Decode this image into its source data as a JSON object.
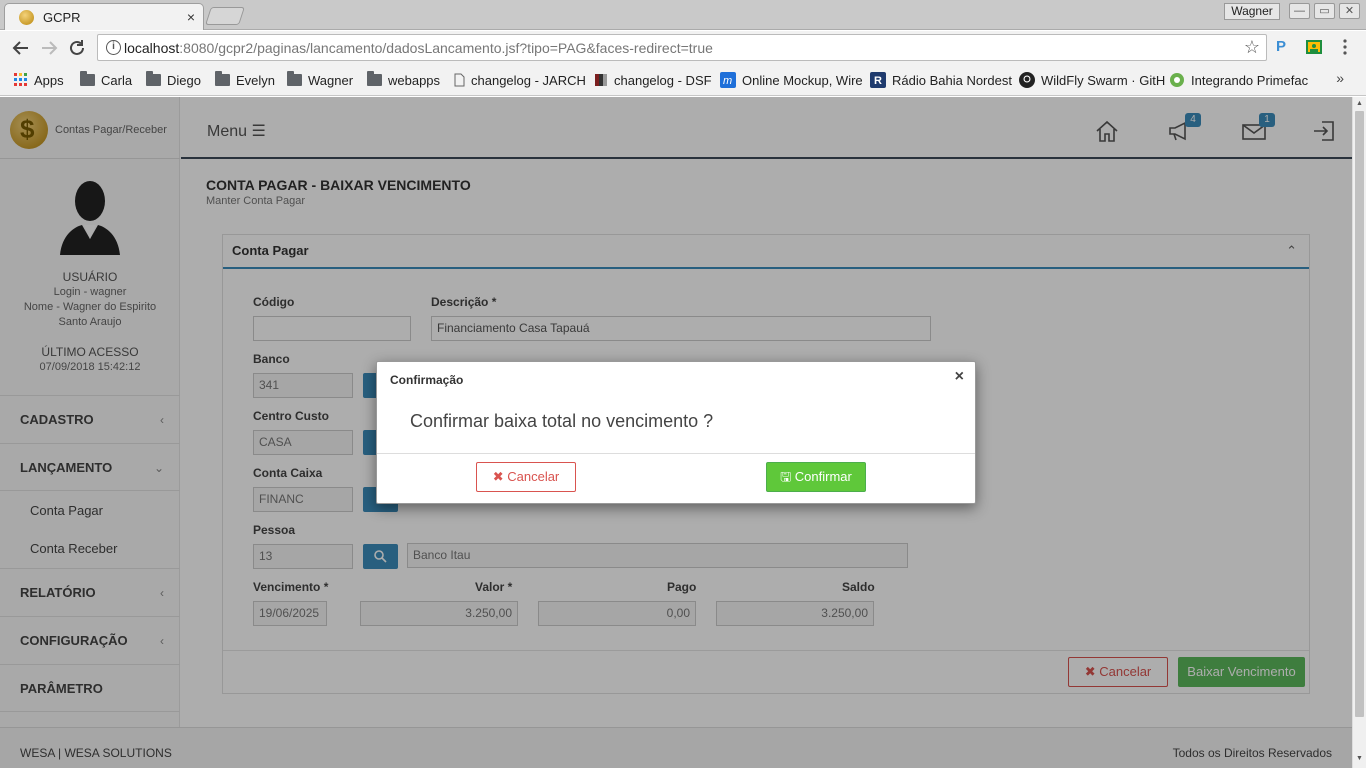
{
  "browser": {
    "tab_title": "GCPR",
    "tab_close": "×",
    "user": "Wagner",
    "window_buttons": [
      "—",
      "▭",
      "✕"
    ],
    "url_host": "localhost",
    "url_rest": ":8080/gcpr2/paginas/lancamento/dadosLancamento.jsf?tipo=PAG&faces-redirect=true",
    "info_glyph": "i",
    "star_glyph": "☆",
    "bookmarks": [
      "Apps",
      "Carla",
      "Diego",
      "Evelyn",
      "Wagner",
      "webapps",
      "changelog - JARCH",
      "changelog - DSF",
      "Online Mockup, Wire",
      "Rádio Bahia Nordest",
      "WildFly Swarm · GitH",
      "Integrando Primefac"
    ],
    "more_glyph": "»"
  },
  "sidebar": {
    "brand_glyph": "$",
    "brand": "Contas Pagar/Receber",
    "user_heading": "USUÁRIO",
    "login": "Login - wagner",
    "name_line1": "Nome - Wagner do Espirito",
    "name_line2": "Santo Araujo",
    "last_access_label": "ÚLTIMO ACESSO",
    "last_access_value": "07/09/2018 15:42:12",
    "menu": [
      "CADASTRO",
      "LANÇAMENTO",
      "RELATÓRIO",
      "CONFIGURAÇÃO",
      "PARÂMETRO"
    ],
    "chevron_left": "‹",
    "chevron_down": "⌄",
    "submenu": [
      "Conta Pagar",
      "Conta Receber"
    ]
  },
  "topbar": {
    "menu_label": "Menu ☰",
    "announcements_badge": "4",
    "messages_badge": "1"
  },
  "page": {
    "title": "CONTA PAGAR - BAIXAR VENCIMENTO",
    "subtitle": "Manter Conta Pagar"
  },
  "panel": {
    "title": "Conta Pagar",
    "collapse_glyph": "⌃",
    "labels": {
      "codigo": "Código",
      "descricao": "Descrição *",
      "banco": "Banco",
      "centro_custo": "Centro Custo",
      "conta_caixa": "Conta Caixa",
      "pessoa": "Pessoa",
      "vencimento": "Vencimento *",
      "valor": "Valor *",
      "pago": "Pago",
      "saldo": "Saldo"
    },
    "values": {
      "codigo": "",
      "descricao": "Financiamento Casa Tapauá",
      "banco": "341",
      "centro_custo": "CASA",
      "conta_caixa": "FINANC",
      "pessoa": "13",
      "pessoa_nome": "Banco Itau",
      "vencimento": "19/06/2025",
      "valor": "3.250,00",
      "pago": "0,00",
      "saldo": "3.250,00"
    },
    "cancel_label": "✖ Cancelar",
    "submit_label": "Baixar Vencimento"
  },
  "footer": {
    "left": "WESA | WESA SOLUTIONS",
    "right": "Todos os Direitos Reservados"
  },
  "dialog": {
    "title": "Confirmação",
    "close": "×",
    "message": "Confirmar baixa total no vencimento ?",
    "cancel_label": "✖ Cancelar",
    "confirm_label": "🖫 Confirmar"
  },
  "colors": {
    "primary": "#3c8dbc",
    "danger": "#d9534f",
    "success": "#5cb85c"
  }
}
